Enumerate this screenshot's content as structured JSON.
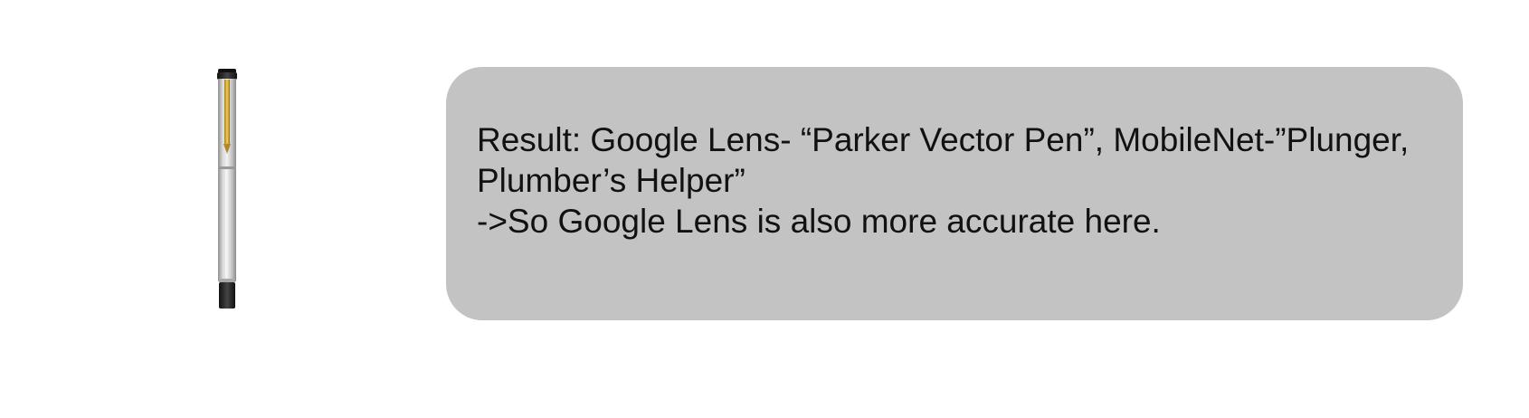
{
  "image": {
    "icon": "pen-icon",
    "alt": ""
  },
  "result": {
    "line1": "Result: Google Lens- “Parker Vector Pen”, MobileNet-”Plunger,",
    "line2": "Plumber’s Helper”",
    "line3": "->So Google Lens is also more accurate here.",
    "box_color": "#c3c3c3"
  }
}
